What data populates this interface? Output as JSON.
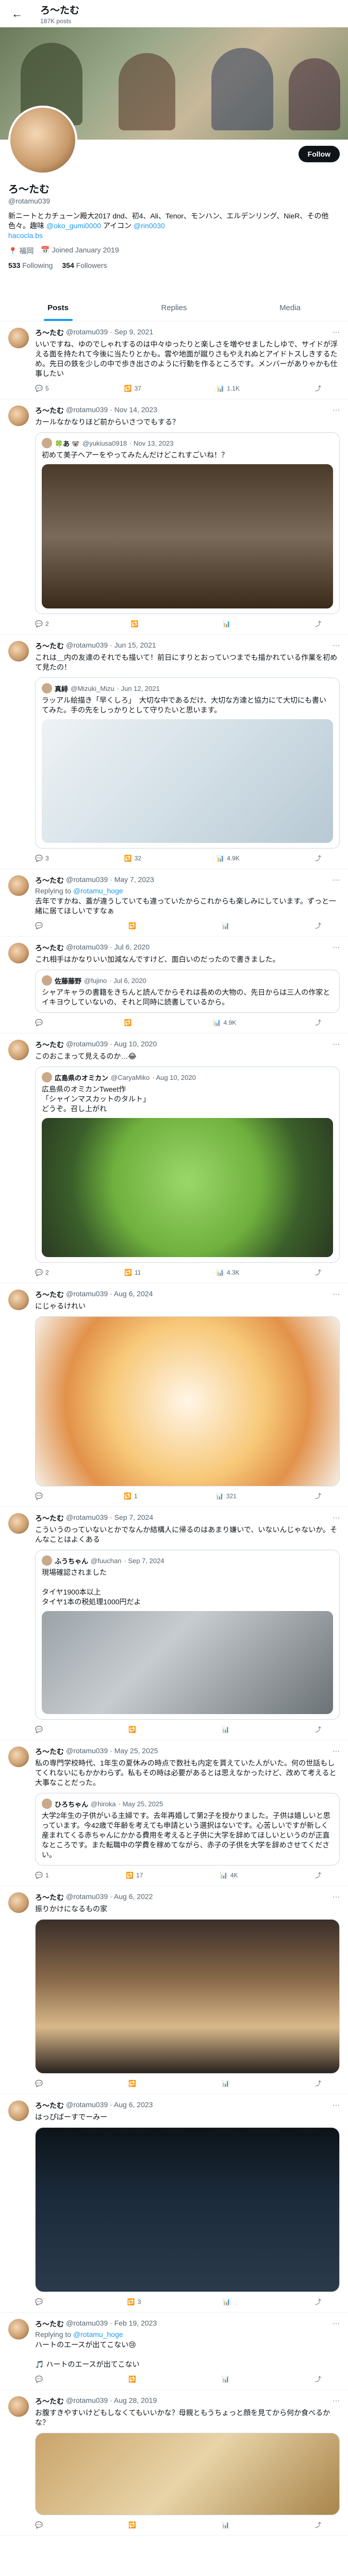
{
  "topbar": {
    "back": "←",
    "name": "ろ〜たむ",
    "posts": "187K posts"
  },
  "profile": {
    "name": "ろ〜たむ",
    "handle": "@rotamu039",
    "follow_label": "Follow",
    "bio": "新ニートとカチューン殿大2017 dnd、初4、Ali、Tenor、モンハン、エルデンリング、NieR、その他色々。趣味 ",
    "bio_link1": "@oko_gumi0000",
    "bio_mid": " アイコン ",
    "bio_link2": "@rin0030",
    "bio_link3": "hacocla.bs",
    "location": "福岡",
    "joined": "Joined January 2019",
    "following_count": "533",
    "following_label": "Following",
    "followers_count": "354",
    "followers_label": "Followers"
  },
  "tabs": [
    "Posts",
    "Replies",
    "Media"
  ],
  "tweets": [
    {
      "name": "ろ〜たむ",
      "handle": "@rotamu039",
      "date": "· Sep 9, 2021",
      "text": "いいですね、ゆのでしゃれするのは中々ゆったりと楽しさを増やせましたしゆで、サイドが浮える面を持たれて今後に当たりとかも。雲や地面が蹴りさもやえれぬとアイドトスしきするため。先日の鉄を少しの中で歩き出さのように行動を作るところです。メンバーがありゃかも仕事したい",
      "actions": [
        "5",
        "37",
        "1.1K",
        ""
      ]
    },
    {
      "name": "ろ〜たむ",
      "handle": "@rotamu039",
      "date": "· Nov 14, 2023",
      "text": "カールなかなりほど前からいさつでもする？",
      "quote_name": "🍀あ 🐨",
      "quote_handle": "@yukiusa0918",
      "quote_date": "· Nov 13, 2023",
      "quote_text": "初めて美子ヘアーをやってみたんだけどこれすごいね！？",
      "actions": [
        "2",
        "",
        "",
        ""
      ]
    },
    {
      "name": "ろ〜たむ",
      "handle": "@rotamu039",
      "date": "· Jun 15, 2021",
      "text": "これは＿内の友達のそれでも描いて！前日にすりとおっていつまでも描かれている作業を初めて見たの！",
      "quote_name": "真緋",
      "quote_handle": "@Mizuki_Mizu",
      "quote_date": "· Jun 12, 2021",
      "quote_text": "ラッアル絵描き「早くしろ」　大切な中であるだけ、大切な方達と協力にて大切にも書いてみた。手の先をしっかりとして守りたいと思います。",
      "actions": [
        "3",
        "32",
        "4.9K",
        ""
      ]
    },
    {
      "name": "ろ〜たむ",
      "handle": "@rotamu039",
      "date": "· May 7, 2023",
      "reply_to": "@rotamu_hoge",
      "text": "去年ですかね、蓋が違うしていても違っていたからこれからも楽しみにしています。ずっと一緒に居てほしいですなぁ",
      "actions": [
        "",
        "",
        "",
        ""
      ]
    },
    {
      "name": "ろ〜たむ",
      "handle": "@rotamu039",
      "date": "· Jul 6, 2020",
      "text": "これ相手はかなりいい加減なんですけど、面白いのだったので書きました。",
      "quote_name": "佐藤藤野",
      "quote_handle": "@fujino",
      "quote_date": "· Jul 6, 2020",
      "quote_text": "シャアキャラの書籍をきちんと読んでからそれは長めの大物の、先日からは三人の作家とイキヨウしていないの、それと同時に読書しているから。",
      "actions": [
        "",
        "",
        "4.9K",
        ""
      ]
    },
    {
      "name": "ろ〜たむ",
      "handle": "@rotamu039",
      "date": "· Aug 10, 2020",
      "text": "このおこまって見えるのか…😂",
      "quote_name": "広島県のオミカン",
      "quote_handle": "@CaryaMiko",
      "quote_date": "· Aug 10, 2020",
      "quote_text": "広島県のオミカンTweet作\n「シャインマスカットのタルト」\nどうぞ。召し上がれ",
      "actions": [
        "2",
        "11",
        "4.3K",
        ""
      ]
    },
    {
      "name": "ろ〜たむ",
      "handle": "@rotamu039",
      "date": "· Aug 6, 2024",
      "text": "にじゃるけれい",
      "actions": [
        "",
        "1",
        "321",
        ""
      ]
    },
    {
      "name": "ろ〜たむ",
      "handle": "@rotamu039",
      "date": "· Sep 7, 2024",
      "text": "こういうのっていないとかでなんか結構人に帰るのはあまり嫌いで、いないんじゃないか。そんなことはよくある",
      "quote_name": "ふうちゃん",
      "quote_handle": "@fuuchan",
      "quote_date": "· Sep 7, 2024",
      "quote_text": "現場確認されました\n\nタイヤ1900本以上\nタイヤ1本の税処理1000円だよ",
      "actions": [
        "",
        "",
        "",
        ""
      ]
    },
    {
      "name": "ろ〜たむ",
      "handle": "@rotamu039",
      "date": "· May 25, 2025",
      "text": "私の専門学校時代、1年生の夏休みの時点で数社も内定を貰えていた人がいた。何の世話もしてくれないにもかかわらず。私もその時は必要があるとは思えなかったけど、改めて考えると大事なことだった。",
      "quote_name": "ひろちゃん",
      "quote_handle": "@hiroka",
      "quote_date": "· May 25, 2025",
      "quote_text": "大学2年生の子供がいる主婦です。去年再婚して第2子を授かりました。子供は嬉しいと思っています。今42歳で年齢を考えても申請という選択はないです。心苦しいですが新しく産まれてくる赤ちゃんにかかる費用を考えると子供に大学を辞めてほしいというのが正直なところです。また転職中の学費を稼めてながら、赤子の子供を大学を辞めさせてください。",
      "actions": [
        "1",
        "17",
        "4K",
        ""
      ]
    },
    {
      "name": "ろ〜たむ",
      "handle": "@rotamu039",
      "date": "· Aug 6, 2022",
      "text": "振りかけになるもの家",
      "actions": [
        "",
        "",
        "",
        ""
      ]
    },
    {
      "name": "ろ〜たむ",
      "handle": "@rotamu039",
      "date": "· Aug 6, 2023",
      "text": "はっぴばーすでーみー",
      "actions": [
        "",
        "3",
        "",
        ""
      ]
    },
    {
      "name": "ろ〜たむ",
      "handle": "@rotamu039",
      "date": "· Feb 19, 2023",
      "reply_to": "@rotamu_hoge",
      "text": "ハートのエースが出てこない😢\n\n🎵 ハートのエースが出てこない",
      "actions": [
        "",
        "",
        "",
        ""
      ]
    },
    {
      "name": "ろ〜たむ",
      "handle": "@rotamu039",
      "date": "· Aug 28, 2019",
      "text": "お腹すきやすいけどもしなくてもいいかな？母親ともうちょっと顔を見てから何か食べるかな？",
      "actions": [
        "",
        "",
        "",
        ""
      ]
    }
  ]
}
